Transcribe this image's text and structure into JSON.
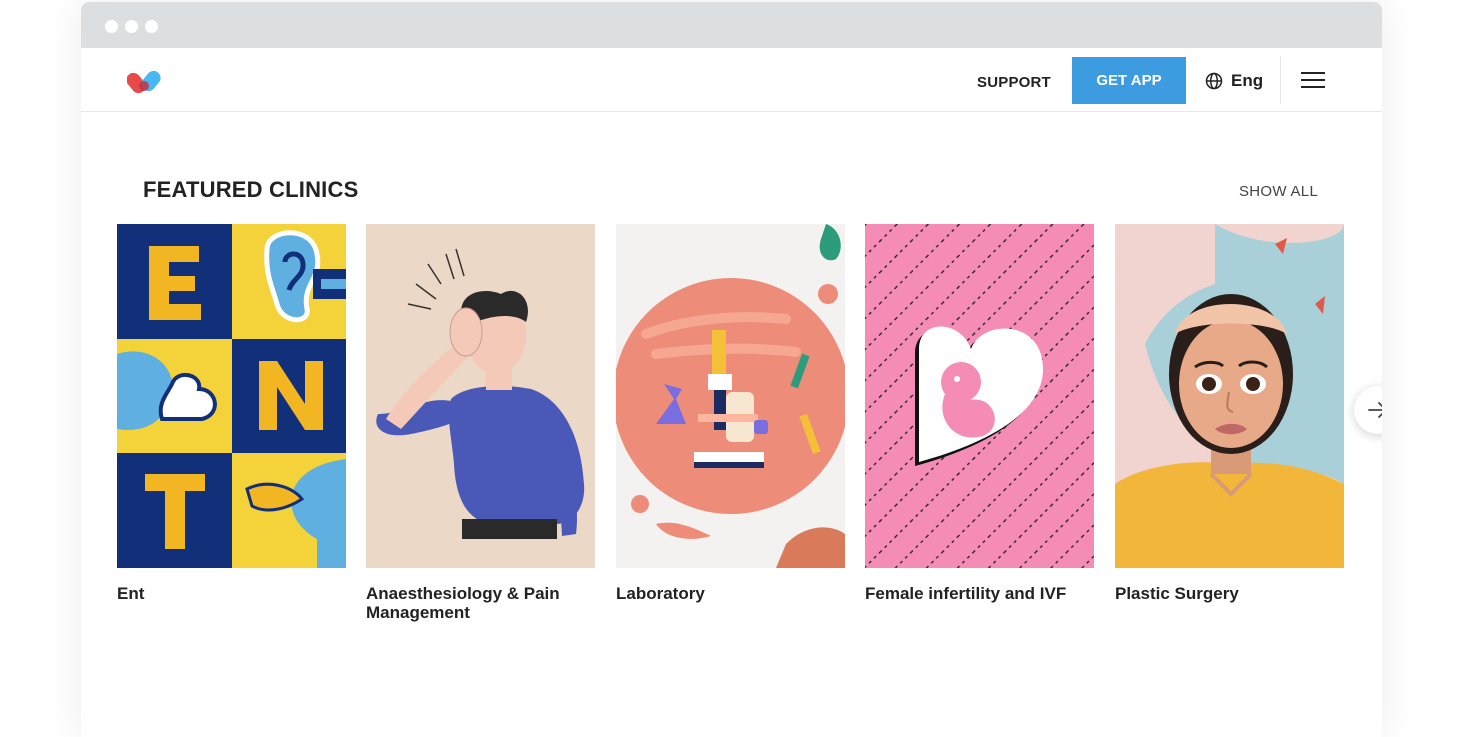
{
  "nav": {
    "support_label": "SUPPORT",
    "get_app_label": "GET APP",
    "language_label": "Eng",
    "logo_icon": "heart-pill-logo",
    "menu_icon": "hamburger-menu-icon",
    "globe_icon": "globe-icon"
  },
  "featured": {
    "title": "FEATURED CLINICS",
    "show_all_label": "SHOW ALL",
    "next_icon": "arrow-right-icon",
    "cards": [
      {
        "name": "Ent",
        "illustration": "ent-illustration"
      },
      {
        "name": "Anaesthesiology & Pain Management",
        "illustration": "headache-man-illustration"
      },
      {
        "name": "Laboratory",
        "illustration": "microscope-illustration"
      },
      {
        "name": "Female infertility and IVF",
        "illustration": "embryo-heart-illustration"
      },
      {
        "name": "Plastic Surgery",
        "illustration": "woman-portrait-illustration"
      }
    ]
  },
  "colors": {
    "accent": "#3d9be0",
    "chrome": "#dcdfe1",
    "text": "#222222"
  }
}
